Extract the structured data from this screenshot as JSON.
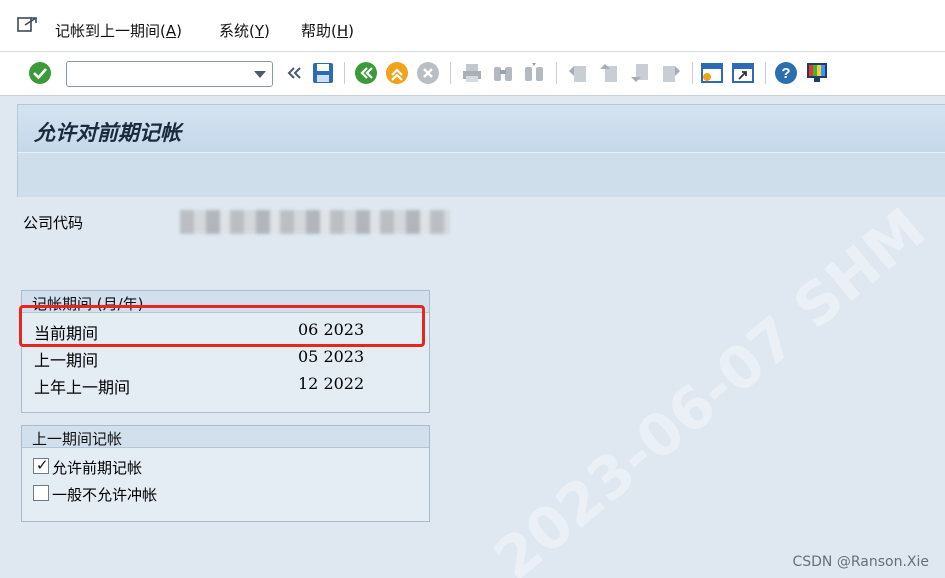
{
  "menu": {
    "items": [
      {
        "label": "记帐到上一期间(",
        "key": "A",
        "suffix": ")"
      },
      {
        "label": "系统(",
        "key": "Y",
        "suffix": ")"
      },
      {
        "label": "帮助(",
        "key": "H",
        "suffix": ")"
      }
    ]
  },
  "toolbar": {
    "command_field_value": "",
    "icons": [
      "enter-check-icon",
      "command-dropdown-icon",
      "collapse-icon",
      "save-icon",
      "back-icon",
      "exit-icon",
      "cancel-icon",
      "print-icon",
      "find-icon",
      "find-next-icon",
      "first-page-icon",
      "previous-page-icon",
      "next-page-icon",
      "last-page-icon",
      "create-session-icon",
      "shortcut-icon",
      "help-icon",
      "customize-layout-icon"
    ],
    "colors": {
      "check": "#3c9a3a",
      "back": "#3c9a3a",
      "exit": "#f0a21a",
      "cancel": "#b9bec5",
      "help": "#2b6fb0"
    }
  },
  "title": "允许对前期记帐",
  "company_code_label": "公司代码",
  "posting_period_group": {
    "title": "记帐期间 (月/年)",
    "rows": [
      {
        "label": "当前期间",
        "value": "06  2023"
      },
      {
        "label": "上一期间",
        "value": "05  2023"
      },
      {
        "label": "上年上一期间",
        "value": "12  2022"
      }
    ]
  },
  "prior_period_group": {
    "title": "上一期间记帐",
    "options": [
      {
        "label": "允许前期记帐",
        "checked": true
      },
      {
        "label": "一般不允许冲帐",
        "checked": false
      }
    ]
  },
  "highlight_color": "#e8251f",
  "watermark": "2023-06-07 SHM",
  "credit": "CSDN @Ranson.Xie"
}
